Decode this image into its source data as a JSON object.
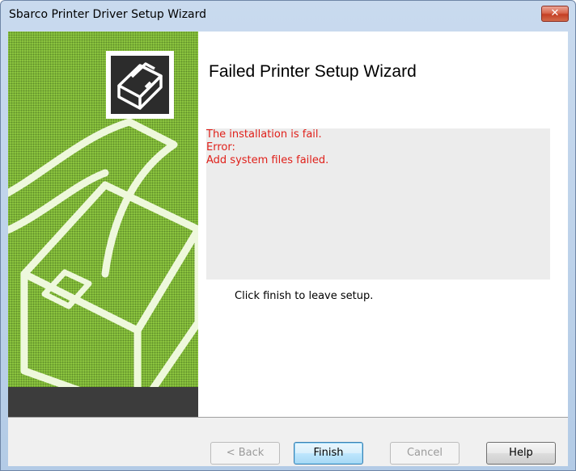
{
  "window": {
    "title": "Sbarco Printer Driver Setup Wizard",
    "close_glyph": "✕"
  },
  "wizard": {
    "heading": "Failed Printer Setup Wizard",
    "message_lines": [
      "The installation is fail.",
      "Error:",
      "Add system files failed."
    ],
    "hint": "Click finish to leave setup."
  },
  "buttons": {
    "back": "< Back",
    "finish": "Finish",
    "cancel": "Cancel",
    "help": "Help"
  },
  "colors": {
    "banner_green": "#8cc63f",
    "error_text": "#e0201a",
    "message_background": "#ececec"
  },
  "icons": {
    "banner_art": "printer-illustration",
    "banner_logo": "printer-icon"
  }
}
